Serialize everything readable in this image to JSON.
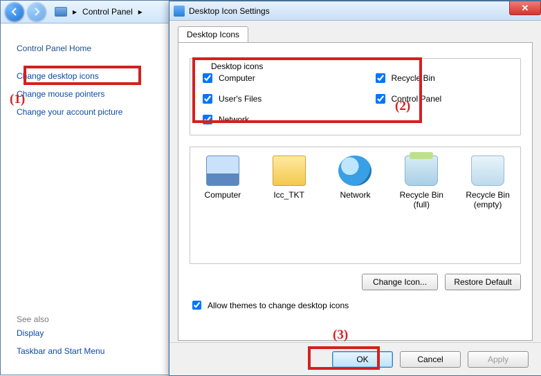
{
  "breadcrumb": {
    "root": "Control Panel"
  },
  "leftPanel": {
    "home": "Control Panel Home",
    "links": [
      "Change desktop icons",
      "Change mouse pointers",
      "Change your account picture"
    ],
    "seeAlsoHeading": "See also",
    "seeAlso": [
      "Display",
      "Taskbar and Start Menu"
    ]
  },
  "dialog": {
    "title": "Desktop Icon Settings",
    "tab": "Desktop Icons",
    "groupLabel": "Desktop icons",
    "checks": {
      "computer": "Computer",
      "usersFiles": "User's Files",
      "network": "Network",
      "recycleBin": "Recycle Bin",
      "controlPanel": "Control Panel"
    },
    "icons": {
      "computer": "Computer",
      "userFolder": "Icc_TKT",
      "network": "Network",
      "binFull": "Recycle Bin (full)",
      "binEmpty": "Recycle Bin (empty)"
    },
    "changeIcon": "Change Icon...",
    "restoreDefault": "Restore Default",
    "allowThemes": "Allow themes to change desktop icons",
    "ok": "OK",
    "cancel": "Cancel",
    "apply": "Apply"
  },
  "annotations": {
    "one": "(1)",
    "two": "(2)",
    "three": "(3)"
  }
}
